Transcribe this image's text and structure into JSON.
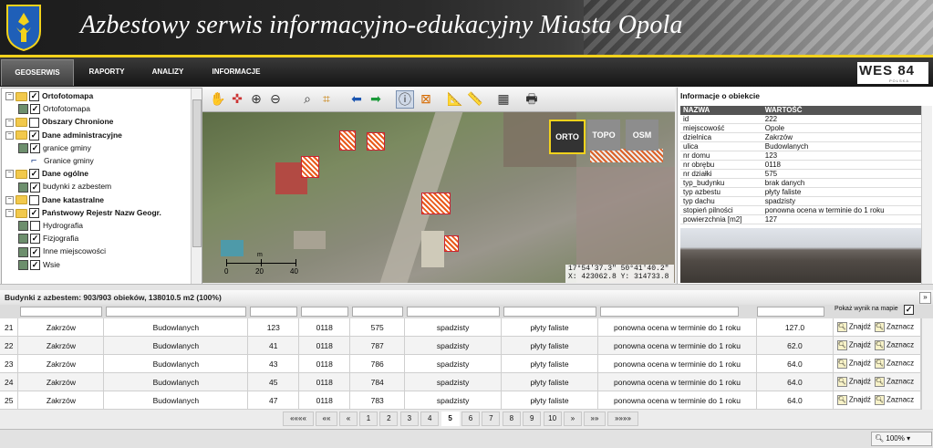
{
  "header": {
    "title": "Azbestowy serwis informacyjno-edukacyjny Miasta Opola"
  },
  "nav": {
    "tabs": [
      {
        "label": "GEOSERWIS",
        "active": true
      },
      {
        "label": "RAPORTY",
        "active": false
      },
      {
        "label": "ANALIZY",
        "active": false
      },
      {
        "label": "INFORMACJE",
        "active": false
      }
    ],
    "brand": {
      "name": "WES 84",
      "sub": "POLSKA"
    }
  },
  "tree": {
    "rows": [
      {
        "label": "Ortofotomapa",
        "bold": true,
        "checked": true,
        "level": 0
      },
      {
        "label": "Ortofotomapa",
        "bold": false,
        "checked": true,
        "level": 1
      },
      {
        "label": "Obszary Chronione",
        "bold": true,
        "checked": false,
        "level": 0
      },
      {
        "label": "Dane administracyjne",
        "bold": true,
        "checked": true,
        "level": 0
      },
      {
        "label": "granice gminy",
        "bold": false,
        "checked": true,
        "level": 1
      },
      {
        "label": "Granice gminy",
        "bold": false,
        "checked": null,
        "level": 2
      },
      {
        "label": "Dane ogólne",
        "bold": true,
        "checked": true,
        "level": 0
      },
      {
        "label": "budynki z azbestem",
        "bold": false,
        "checked": true,
        "level": 1
      },
      {
        "label": "Dane katastralne",
        "bold": true,
        "checked": false,
        "level": 0
      },
      {
        "label": "Państwowy Rejestr Nazw Geogr.",
        "bold": true,
        "checked": true,
        "level": 0
      },
      {
        "label": "Hydrografia",
        "bold": false,
        "checked": false,
        "level": 1
      },
      {
        "label": "Fizjografia",
        "bold": false,
        "checked": true,
        "level": 1
      },
      {
        "label": "Inne miejscowości",
        "bold": false,
        "checked": true,
        "level": 1
      },
      {
        "label": "Wsie",
        "bold": false,
        "checked": true,
        "level": 1
      }
    ]
  },
  "map": {
    "buttons": [
      "ORTO",
      "TOPO",
      "OSM"
    ],
    "scale_ticks": [
      "0",
      "20",
      "40"
    ],
    "scale_unit": "m",
    "coords_line1": "17°54'37.3\" 50°41'40.2\"",
    "coords_line2": "X: 423062.8 Y: 314733.8"
  },
  "info": {
    "title": "Informacje o obiekcie",
    "headers": [
      "NAZWA",
      "WARTOŚĆ"
    ],
    "rows": [
      [
        "id",
        "222"
      ],
      [
        "miejscowość",
        "Opole"
      ],
      [
        "dzielnica",
        "Zakrzów"
      ],
      [
        "ulica",
        "Budowlanych"
      ],
      [
        "nr domu",
        "123"
      ],
      [
        "nr obrębu",
        "0118"
      ],
      [
        "nr działki",
        "575"
      ],
      [
        "typ_budynku",
        "brak danych"
      ],
      [
        "typ azbestu",
        "płyty faliste"
      ],
      [
        "typ dachu",
        "spadzisty"
      ],
      [
        "stopień pilności",
        "ponowna ocena w terminie do 1 roku"
      ],
      [
        "powierzchnia [m2]",
        "127"
      ]
    ]
  },
  "results": {
    "title": "Budynki z azbestem: 903/903 obieków, 138010.5 m2 (100%)",
    "show_on_map_label": "Pokaż wynik na mapie",
    "find_label": "Znajdź",
    "select_label": "Zaznacz",
    "rows": [
      [
        "21",
        "Zakrzów",
        "Budowlanych",
        "123",
        "0118",
        "575",
        "spadzisty",
        "płyty faliste",
        "ponowna ocena w terminie do 1 roku",
        "127.0"
      ],
      [
        "22",
        "Zakrzów",
        "Budowlanych",
        "41",
        "0118",
        "787",
        "spadzisty",
        "płyty faliste",
        "ponowna ocena w terminie do 1 roku",
        "62.0"
      ],
      [
        "23",
        "Zakrzów",
        "Budowlanych",
        "43",
        "0118",
        "786",
        "spadzisty",
        "płyty faliste",
        "ponowna ocena w terminie do 1 roku",
        "64.0"
      ],
      [
        "24",
        "Zakrzów",
        "Budowlanych",
        "45",
        "0118",
        "784",
        "spadzisty",
        "płyty faliste",
        "ponowna ocena w terminie do 1 roku",
        "64.0"
      ],
      [
        "25",
        "Zakrzów",
        "Budowlanych",
        "47",
        "0118",
        "783",
        "spadzisty",
        "płyty faliste",
        "ponowna ocena w terminie do 1 roku",
        "64.0"
      ]
    ]
  },
  "pager": {
    "first": "««««",
    "prev_many": "««",
    "prev": "«",
    "pages": [
      "1",
      "2",
      "3",
      "4",
      "5",
      "6",
      "7",
      "8",
      "9",
      "10"
    ],
    "current": "5",
    "next": "»",
    "next_many": "»»",
    "last": "»»»»"
  },
  "status": {
    "zoom": "100%"
  }
}
